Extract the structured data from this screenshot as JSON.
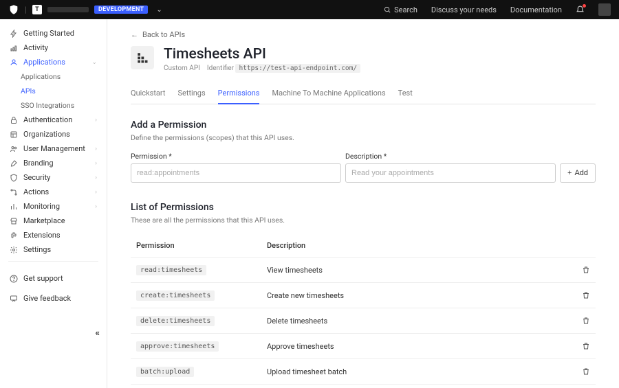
{
  "topbar": {
    "tenant_initial": "T",
    "env_badge": "DEVELOPMENT",
    "search_label": "Search",
    "discuss_label": "Discuss your needs",
    "docs_label": "Documentation"
  },
  "sidebar": {
    "items": [
      {
        "icon": "bolt",
        "label": "Getting Started"
      },
      {
        "icon": "chart",
        "label": "Activity"
      },
      {
        "icon": "apps",
        "label": "Applications",
        "active": true,
        "expanded": true
      },
      {
        "sub": true,
        "label": "Applications"
      },
      {
        "sub": true,
        "label": "APIs",
        "active": true
      },
      {
        "sub": true,
        "label": "SSO Integrations"
      },
      {
        "icon": "lock",
        "label": "Authentication",
        "expandable": true
      },
      {
        "icon": "org",
        "label": "Organizations"
      },
      {
        "icon": "users",
        "label": "User Management",
        "expandable": true
      },
      {
        "icon": "brush",
        "label": "Branding",
        "expandable": true
      },
      {
        "icon": "shield",
        "label": "Security",
        "expandable": true
      },
      {
        "icon": "flow",
        "label": "Actions",
        "expandable": true
      },
      {
        "icon": "bars",
        "label": "Monitoring",
        "expandable": true
      },
      {
        "icon": "store",
        "label": "Marketplace"
      },
      {
        "icon": "puzzle",
        "label": "Extensions"
      },
      {
        "icon": "gear",
        "label": "Settings"
      }
    ],
    "footer": [
      {
        "icon": "help",
        "label": "Get support"
      },
      {
        "icon": "feedback",
        "label": "Give feedback"
      }
    ]
  },
  "main": {
    "back_label": "Back to APIs",
    "api_title": "Timesheets API",
    "api_type": "Custom API",
    "identifier_label": "Identifier",
    "identifier_value": "https://test-api-endpoint.com/",
    "tabs": [
      {
        "label": "Quickstart"
      },
      {
        "label": "Settings"
      },
      {
        "label": "Permissions",
        "active": true
      },
      {
        "label": "Machine To Machine Applications"
      },
      {
        "label": "Test"
      }
    ],
    "add_section": {
      "title": "Add a Permission",
      "desc": "Define the permissions (scopes) that this API uses.",
      "perm_label": "Permission *",
      "perm_placeholder": "read:appointments",
      "desc_label": "Description *",
      "desc_placeholder": "Read your appointments",
      "add_btn": "Add"
    },
    "list_section": {
      "title": "List of Permissions",
      "desc": "These are all the permissions that this API uses.",
      "col_perm": "Permission",
      "col_desc": "Description",
      "rows": [
        {
          "scope": "read:timesheets",
          "desc": "View timesheets"
        },
        {
          "scope": "create:timesheets",
          "desc": "Create new timesheets"
        },
        {
          "scope": "delete:timesheets",
          "desc": "Delete timesheets"
        },
        {
          "scope": "approve:timesheets",
          "desc": "Approve timesheets"
        },
        {
          "scope": "batch:upload",
          "desc": "Upload timesheet batch"
        }
      ]
    }
  }
}
